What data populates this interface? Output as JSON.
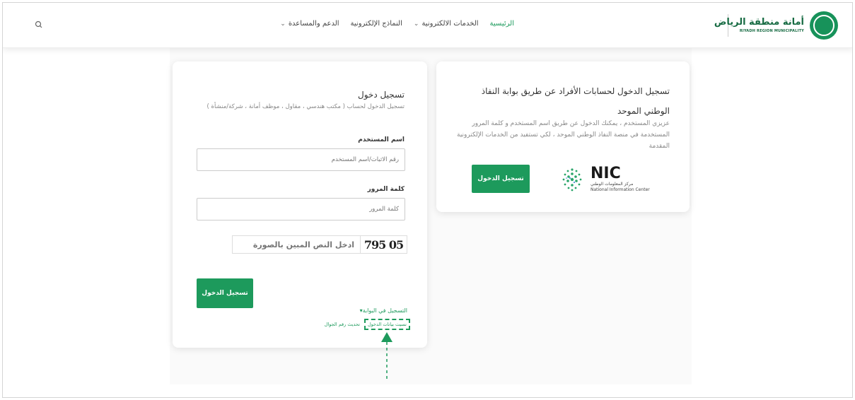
{
  "header": {
    "logo_ar": "أمانة منطقة الرياض",
    "logo_en": "RIYADH REGION MUNICIPALITY",
    "nav": [
      {
        "label": "الرئيسية",
        "active": true,
        "has_dropdown": false
      },
      {
        "label": "الخدمات الالكترونية",
        "active": false,
        "has_dropdown": true
      },
      {
        "label": "النماذج الإلكترونية",
        "active": false,
        "has_dropdown": false
      },
      {
        "label": "الدعم والمساعدة",
        "active": false,
        "has_dropdown": true
      }
    ],
    "search_icon": "search-icon"
  },
  "login": {
    "title": "تسجيل دخول",
    "subtitle": "تسجيل الدخول لحساب ( مكتب هندسي ، مقاول ، موظف أمانة ، شركة/منشأة )",
    "username_label": "اسم المستخدم",
    "username_placeholder": "رقم الاثبات/اسم المستخدم",
    "password_label": "كلمة المرور",
    "password_placeholder": "كلمة المرور",
    "captcha_text": "05 795",
    "captcha_placeholder": "ادخل النص المبين بالصورة",
    "login_button": "تسجيل الدخول",
    "register_link": "التسجيل في البوابة",
    "forgot_link": "نسيت بيانات الدخول",
    "update_mobile_link": "تحديث رقم الجوال"
  },
  "nafath": {
    "title": "تسجيل الدخول لحسابات الأفراد عن طريق بوابة النفاذ الوطني الموحد",
    "description": "عزيزي المستخدم ، يمكنك الدخول عن طريق اسم المستخدم و كلمة المرور المستخدمة في منصة النفاذ الوطني الموحد ، لكي تستفيد من الخدمات الإلكترونية المقدمة",
    "login_button": "تسجيل الدخول",
    "nic_logo": "NIC",
    "nic_ar": "مركز المعلومات الوطني",
    "nic_en": "National Information Center"
  },
  "colors": {
    "accent": "#1d9a5c",
    "brand": "#176b43"
  }
}
